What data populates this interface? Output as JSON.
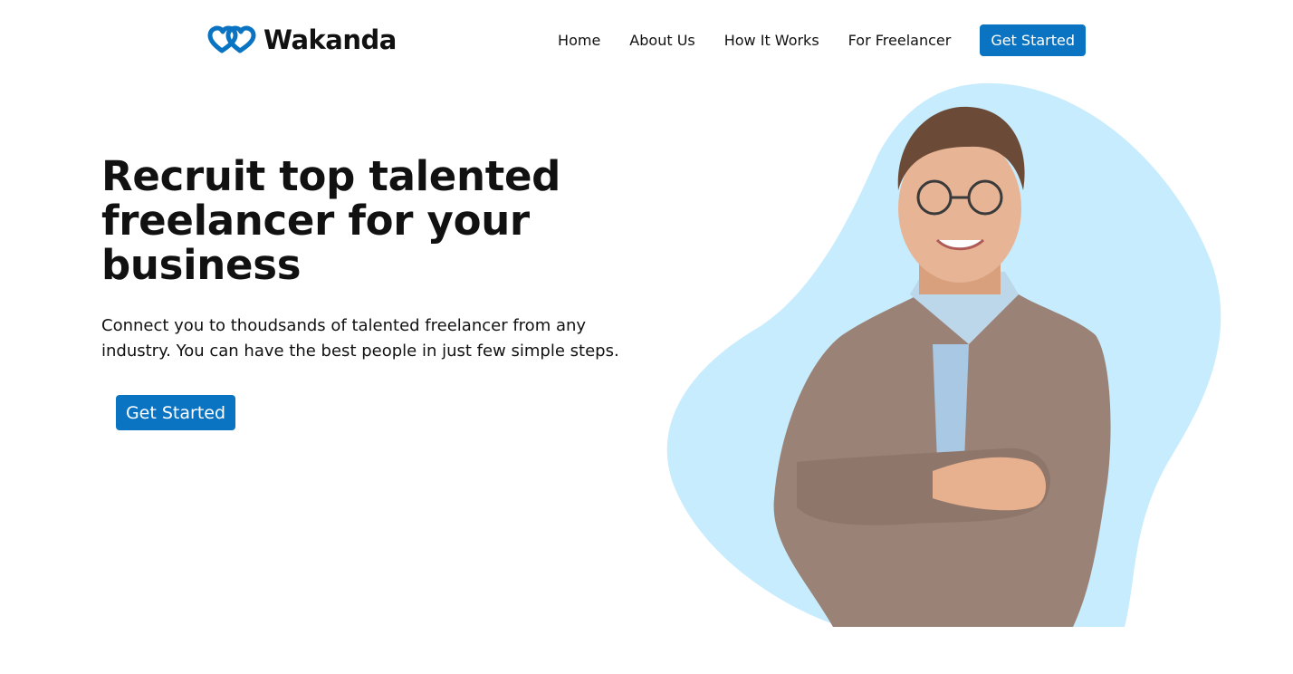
{
  "brand": {
    "name": "Wakanda",
    "logo_icon": "hearts-logo-icon",
    "accent": "#0a74c2"
  },
  "nav": {
    "items": [
      {
        "label": "Home"
      },
      {
        "label": "About Us"
      },
      {
        "label": "How It Works"
      },
      {
        "label": "For Freelancer"
      }
    ],
    "cta_label": "Get Started"
  },
  "hero": {
    "title": "Recruit top talented freelancer for your business",
    "subtitle": "Connect you to thoudsands of talented freelancer from any industry. You can have the best people in just few simple steps.",
    "cta_label": "Get Started",
    "image": "man-in-plaid-blazer-photo",
    "blob_color": "#c6ecfd"
  }
}
